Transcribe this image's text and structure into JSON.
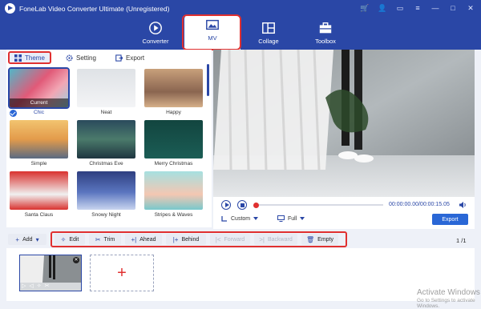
{
  "app": {
    "title": "FoneLab Video Converter Ultimate (Unregistered)"
  },
  "nav": {
    "tabs": [
      {
        "label": "Converter",
        "icon": "converter-icon"
      },
      {
        "label": "MV",
        "icon": "mv-icon",
        "active": true
      },
      {
        "label": "Collage",
        "icon": "collage-icon"
      },
      {
        "label": "Toolbox",
        "icon": "toolbox-icon"
      }
    ]
  },
  "subtabs": {
    "theme": "Theme",
    "setting": "Setting",
    "export": "Export"
  },
  "themes": [
    {
      "label": "Chic",
      "badge": "Current",
      "selected": true
    },
    {
      "label": "Neat"
    },
    {
      "label": "Happy"
    },
    {
      "label": "Simple"
    },
    {
      "label": "Christmas Eve"
    },
    {
      "label": "Merry Christmas"
    },
    {
      "label": "Santa Claus"
    },
    {
      "label": "Snowy Night"
    },
    {
      "label": "Stripes & Waves"
    }
  ],
  "player": {
    "timecode": "00:00:00.00/00:00:15.05",
    "aspect": "Custom",
    "mode": "Full",
    "export_label": "Export"
  },
  "toolbar": {
    "add": "Add",
    "edit": "Edit",
    "trim": "Trim",
    "ahead": "Ahead",
    "behind": "Behind",
    "forward": "Forward",
    "backward": "Backward",
    "empty": "Empty",
    "page_current": "1",
    "page_total": "/1"
  },
  "watermark": {
    "line1": "Activate Windows",
    "line2": "Go to Settings to activate Windows."
  },
  "colors": {
    "brand": "#2a47a6",
    "accent": "#e03030",
    "button": "#2a67d6"
  }
}
